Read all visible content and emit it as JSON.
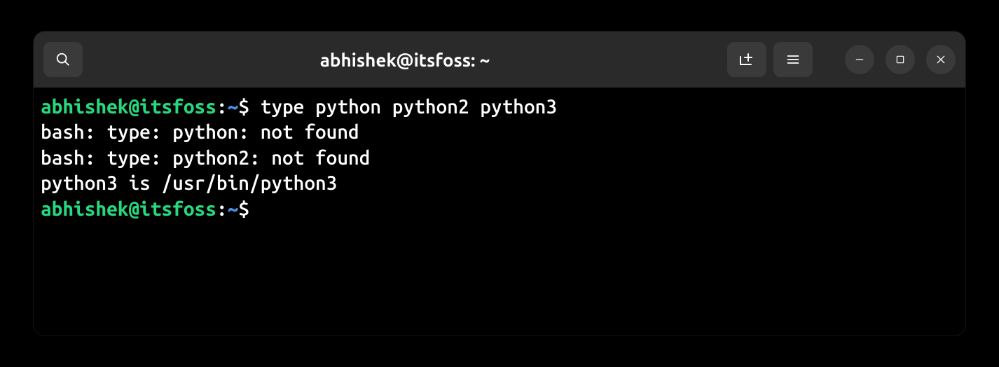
{
  "titlebar": {
    "title": "abhishek@itsfoss: ~"
  },
  "prompt": {
    "user_host": "abhishek@itsfoss",
    "colon": ":",
    "cwd": "~",
    "dollar": "$"
  },
  "session": {
    "command1": " type python python2 python3",
    "output1": "bash: type: python: not found",
    "output2": "bash: type: python2: not found",
    "output3": "python3 is /usr/bin/python3",
    "command2": " "
  }
}
